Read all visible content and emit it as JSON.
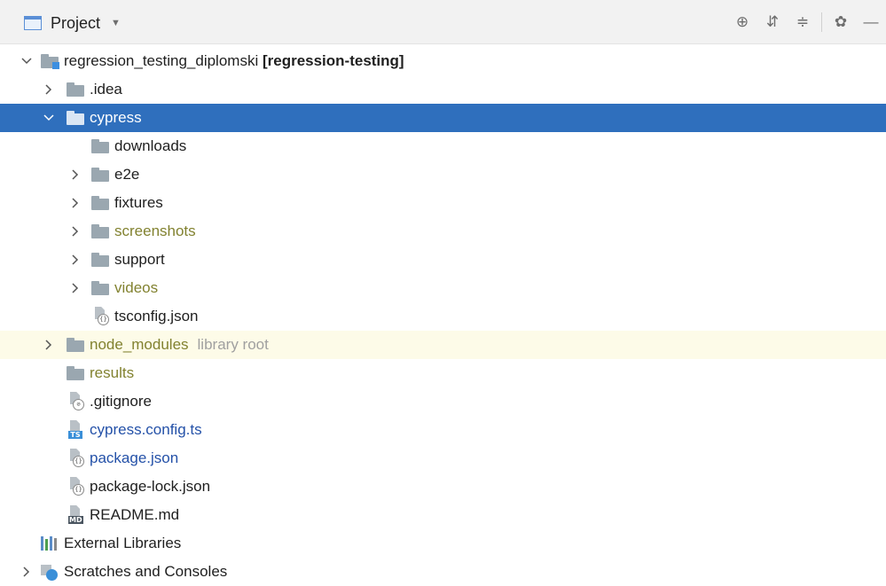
{
  "toolbar": {
    "view_label": "Project",
    "view_icon": "project-view-icon",
    "dropdown_icon": "chevron-down-icon",
    "actions": [
      {
        "name": "locate-file-icon",
        "glyph": "⊕"
      },
      {
        "name": "expand-all-icon",
        "glyph": "⇵"
      },
      {
        "name": "collapse-all-icon",
        "glyph": "≑"
      },
      {
        "name": "settings-gear-icon",
        "glyph": "✿"
      },
      {
        "name": "hide-panel-icon",
        "glyph": "—"
      }
    ]
  },
  "tree": [
    {
      "level": 0,
      "arrow": "down",
      "icon": "module-folder",
      "label": "regression_testing_diplomski",
      "suffix": "[regression-testing]"
    },
    {
      "level": 1,
      "arrow": "right",
      "icon": "folder",
      "label": ".idea"
    },
    {
      "level": 1,
      "arrow": "down",
      "icon": "folder",
      "label": "cypress",
      "selected": true
    },
    {
      "level": 2,
      "arrow": "none",
      "icon": "folder",
      "label": "downloads"
    },
    {
      "level": 2,
      "arrow": "right",
      "icon": "folder",
      "label": "e2e"
    },
    {
      "level": 2,
      "arrow": "right",
      "icon": "folder",
      "label": "fixtures"
    },
    {
      "level": 2,
      "arrow": "right",
      "icon": "folder",
      "label": "screenshots",
      "style": "excluded"
    },
    {
      "level": 2,
      "arrow": "right",
      "icon": "folder",
      "label": "support"
    },
    {
      "level": 2,
      "arrow": "right",
      "icon": "folder",
      "label": "videos",
      "style": "excluded"
    },
    {
      "level": 2,
      "arrow": "none",
      "icon": "json-file",
      "label": "tsconfig.json"
    },
    {
      "level": 1,
      "arrow": "right",
      "icon": "folder",
      "label": "node_modules",
      "style": "excluded",
      "secondary": "library root",
      "library": true
    },
    {
      "level": 1,
      "arrow": "none",
      "icon": "folder",
      "label": "results",
      "style": "excluded"
    },
    {
      "level": 1,
      "arrow": "none",
      "icon": "ignore-file",
      "label": ".gitignore"
    },
    {
      "level": 1,
      "arrow": "none",
      "icon": "ts-file",
      "label": "cypress.config.ts",
      "style": "vcs"
    },
    {
      "level": 1,
      "arrow": "none",
      "icon": "json-file",
      "label": "package.json",
      "style": "vcs"
    },
    {
      "level": 1,
      "arrow": "none",
      "icon": "json-file",
      "label": "package-lock.json"
    },
    {
      "level": 1,
      "arrow": "none",
      "icon": "md-file",
      "label": "README.md"
    },
    {
      "level": 0,
      "arrow": "none",
      "icon": "libraries",
      "label": "External Libraries"
    },
    {
      "level": 0,
      "arrow": "right",
      "icon": "scratches",
      "label": "Scratches and Consoles"
    }
  ],
  "file_tags": {
    "ts": "TS",
    "md": "MD",
    "json_badge": "{}",
    "ignore_badge": "⊘"
  },
  "colors": {
    "selection": "#2f6fbd",
    "library_row": "#fdfbe8",
    "excluded_text": "#828230",
    "vcs_modified_text": "#2451a8",
    "folder": "#9aa7b0"
  }
}
